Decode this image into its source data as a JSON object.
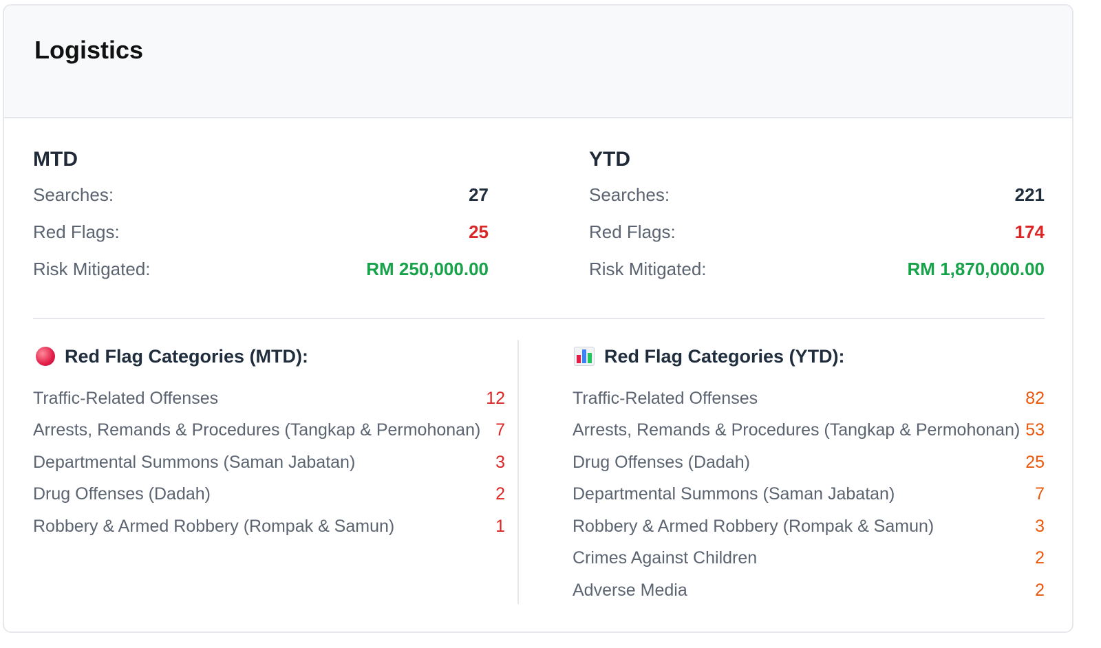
{
  "card": {
    "title": "Logistics"
  },
  "mtd": {
    "title": "MTD",
    "searches_label": "Searches:",
    "searches": "27",
    "red_flags_label": "Red Flags:",
    "red_flags": "25",
    "risk_label": "Risk Mitigated:",
    "risk": "RM 250,000.00"
  },
  "ytd": {
    "title": "YTD",
    "searches_label": "Searches:",
    "searches": "221",
    "red_flags_label": "Red Flags:",
    "red_flags": "174",
    "risk_label": "Risk Mitigated:",
    "risk": "RM 1,870,000.00"
  },
  "mtd_categories": {
    "title": "Red Flag Categories (MTD):",
    "icon": "red-circle-icon",
    "items": [
      {
        "name": "Traffic-Related Offenses",
        "count": "12"
      },
      {
        "name": "Arrests, Remands & Procedures (Tangkap & Permohonan)",
        "count": "7"
      },
      {
        "name": "Departmental Summons (Saman Jabatan)",
        "count": "3"
      },
      {
        "name": "Drug Offenses (Dadah)",
        "count": "2"
      },
      {
        "name": "Robbery & Armed Robbery (Rompak & Samun)",
        "count": "1"
      }
    ]
  },
  "ytd_categories": {
    "title": "Red Flag Categories (YTD):",
    "icon": "bar-chart-icon",
    "items": [
      {
        "name": "Traffic-Related Offenses",
        "count": "82"
      },
      {
        "name": "Arrests, Remands & Procedures (Tangkap & Permohonan)",
        "count": "53"
      },
      {
        "name": "Drug Offenses (Dadah)",
        "count": "25"
      },
      {
        "name": "Departmental Summons (Saman Jabatan)",
        "count": "7"
      },
      {
        "name": "Robbery & Armed Robbery (Rompak & Samun)",
        "count": "3"
      },
      {
        "name": "Crimes Against Children",
        "count": "2"
      },
      {
        "name": "Adverse Media",
        "count": "2"
      }
    ]
  },
  "colors": {
    "value_dark": "#1f2d3d",
    "red_flag": "#dc2626",
    "risk_green": "#16a34a",
    "ytd_count_orange": "#ea580c"
  }
}
